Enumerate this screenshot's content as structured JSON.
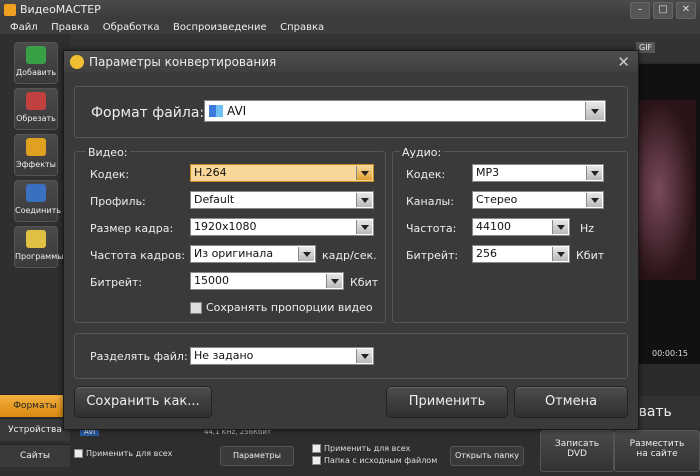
{
  "app": {
    "title": "ВидеоМАСТЕР",
    "menu": [
      "Файл",
      "Правка",
      "Обработка",
      "Воспроизведение",
      "Справка"
    ]
  },
  "sidebar": {
    "items": [
      {
        "label": "Добавить",
        "icon": "add-film-icon"
      },
      {
        "label": "Обрезать",
        "icon": "scissors-icon"
      },
      {
        "label": "Эффекты",
        "icon": "effects-icon"
      },
      {
        "label": "Соединить",
        "icon": "join-icon"
      },
      {
        "label": "Программы",
        "icon": "programs-icon"
      }
    ],
    "tabs": [
      {
        "label": "Форматы",
        "active": true
      },
      {
        "label": "Устройства",
        "active": false
      },
      {
        "label": "Сайты",
        "active": false
      }
    ]
  },
  "background": {
    "gif_label": "GIF",
    "time": "00:00:15",
    "convert_label": "овать",
    "dvd_button": [
      "Записать",
      "DVD"
    ],
    "site_button": [
      "Разместить",
      "на сайте"
    ],
    "apply_all_left": "Применить для всех",
    "params_button": "Параметры",
    "apply_all_right": "Применить для всех",
    "source_folder": "Папка с исходным файлом",
    "open_folder": "Открыть папку",
    "avi_badge": "AVI",
    "audio_info": "44,1 KHz, 256Кбит"
  },
  "dialog": {
    "title": "Параметры конвертирования",
    "format_label": "Формат файла:",
    "format_value": "AVI",
    "video": {
      "section": "Видео:",
      "codec_label": "Кодек:",
      "codec": "H.264",
      "profile_label": "Профиль:",
      "profile": "Default",
      "frame_size_label": "Размер кадра:",
      "frame_size": "1920x1080",
      "fps_label": "Частота кадров:",
      "fps": "Из оригинала",
      "fps_unit": "кадр/сек.",
      "bitrate_label": "Битрейт:",
      "bitrate": "15000",
      "bitrate_unit": "Кбит",
      "keep_ratio": "Сохранять пропорции видео"
    },
    "audio": {
      "section": "Аудио:",
      "codec_label": "Кодек:",
      "codec": "MP3",
      "channels_label": "Каналы:",
      "channels": "Стерео",
      "freq_label": "Частота:",
      "freq": "44100",
      "freq_unit": "Hz",
      "bitrate_label": "Битрейт:",
      "bitrate": "256",
      "bitrate_unit": "Кбит"
    },
    "split_label": "Разделять файл:",
    "split_value": "Не задано",
    "buttons": {
      "save_as": "Сохранить как...",
      "apply": "Применить",
      "cancel": "Отмена"
    }
  }
}
